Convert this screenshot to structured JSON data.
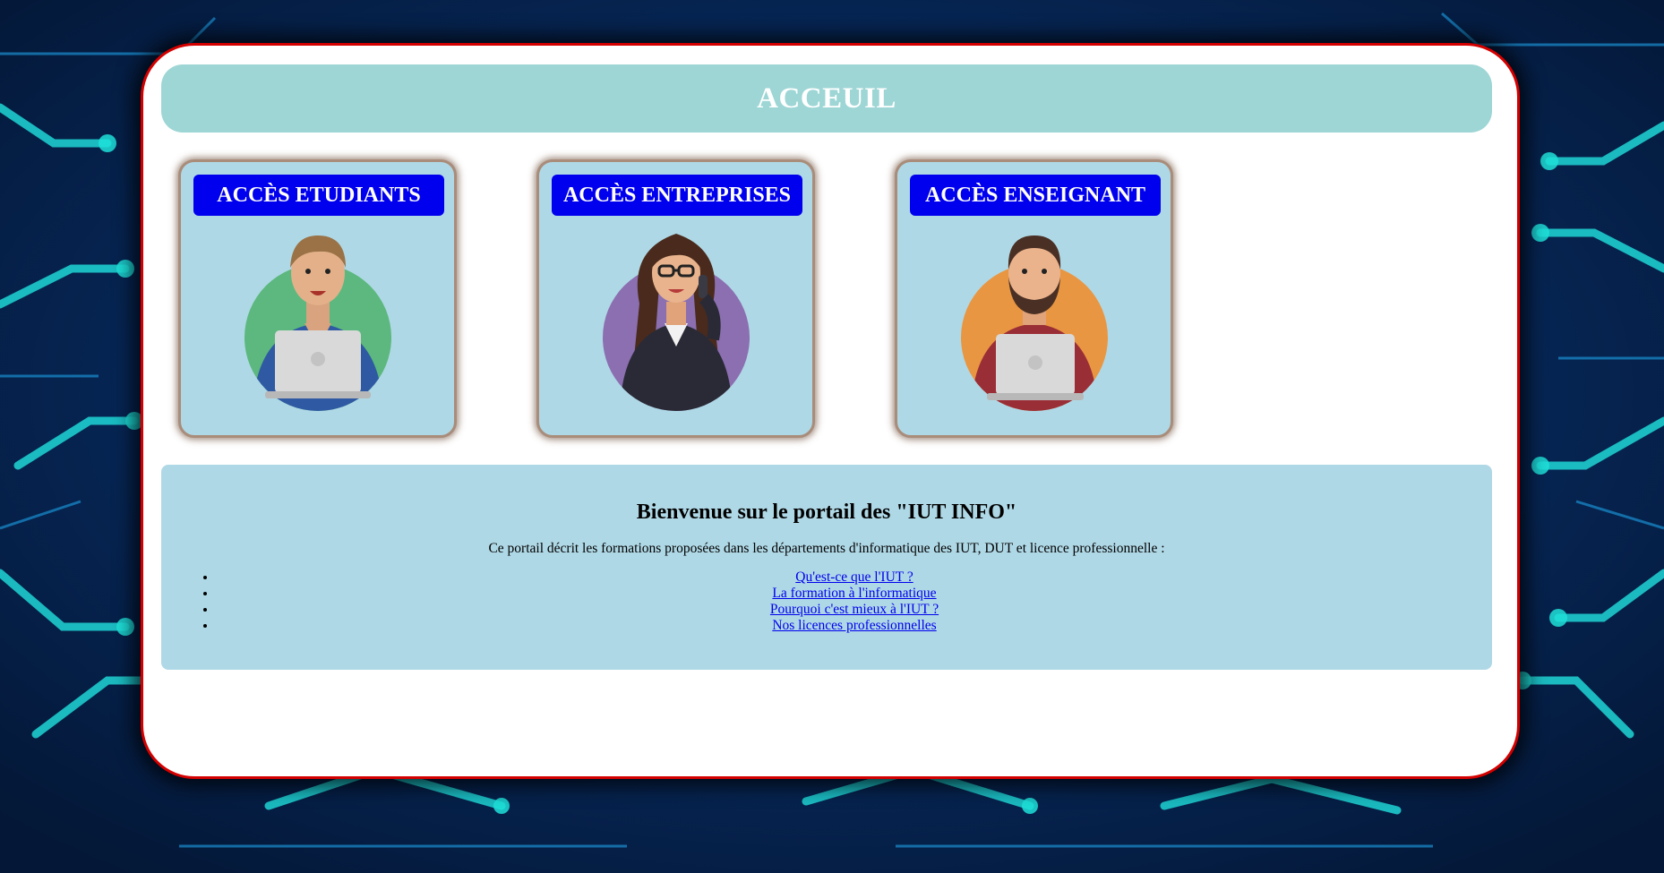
{
  "header": {
    "title": "ACCEUIL"
  },
  "tiles": [
    {
      "label": "ACCÈS ETUDIANTS",
      "icon": "student-avatar-icon",
      "circle_color": "#5cb87e"
    },
    {
      "label": "ACCÈS ENTREPRISES",
      "icon": "businesswoman-avatar-icon",
      "circle_color": "#8b6fb0"
    },
    {
      "label": "ACCÈS ENSEIGNANT",
      "icon": "teacher-avatar-icon",
      "circle_color": "#e99642"
    }
  ],
  "welcome": {
    "title": "Bienvenue sur le portail des \"IUT INFO\"",
    "intro": "Ce portail décrit les formations proposées dans les départements d'informatique des IUT, DUT et licence professionnelle :",
    "links": [
      "Qu'est-ce que l'IUT ?",
      "La formation à l'informatique",
      "Pourquoi c'est mieux à l'IUT ?",
      "Nos licences professionnelles"
    ]
  },
  "colors": {
    "card_border": "#d40000",
    "header_bg": "#9dd6d5",
    "tile_bg": "#afd8e6",
    "button_bg": "#0000ee",
    "link": "#0000ee"
  },
  "background": {
    "icon": "circuit-board-background"
  }
}
